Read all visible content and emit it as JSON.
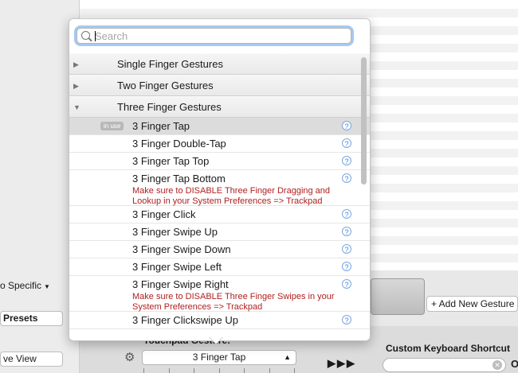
{
  "search": {
    "placeholder": "Search",
    "value": ""
  },
  "groups": [
    {
      "label": "Single Finger Gestures",
      "expanded": false
    },
    {
      "label": "Two Finger Gestures",
      "expanded": false
    },
    {
      "label": "Three Finger Gestures",
      "expanded": true
    }
  ],
  "items": [
    {
      "label": "3 Finger Tap",
      "badge": "in use",
      "selected": true
    },
    {
      "label": "3 Finger Double-Tap"
    },
    {
      "label": "3 Finger Tap Top"
    },
    {
      "label": "3 Finger Tap Bottom",
      "warning": "Make sure to DISABLE Three Finger Dragging and Lookup in your System Preferences => Trackpad"
    },
    {
      "label": "3 Finger Click"
    },
    {
      "label": "3 Finger Swipe Up"
    },
    {
      "label": "3 Finger Swipe Down"
    },
    {
      "label": "3 Finger Swipe Left"
    },
    {
      "label": "3 Finger Swipe Right",
      "warning": "Make sure to DISABLE Three Finger Swipes in your System Preferences => Trackpad"
    },
    {
      "label": "3 Finger Clickswipe Up"
    }
  ],
  "help_glyph": "?",
  "background": {
    "left_specific": "o Specific",
    "left_presets": "Presets",
    "left_view": "ve View",
    "add_gesture": "+ Add New Gesture",
    "gesture_label": "Touchpad Gesture:",
    "gesture_select": "3 Finger Tap",
    "arrows": "▶▶▶",
    "kb_label": "Custom Keyboard Shortcut",
    "kb_trailing": "O"
  },
  "colors": {
    "warning": "#b02020",
    "focus_ring": "#a8c8f0",
    "help": "#3b7fd9"
  }
}
